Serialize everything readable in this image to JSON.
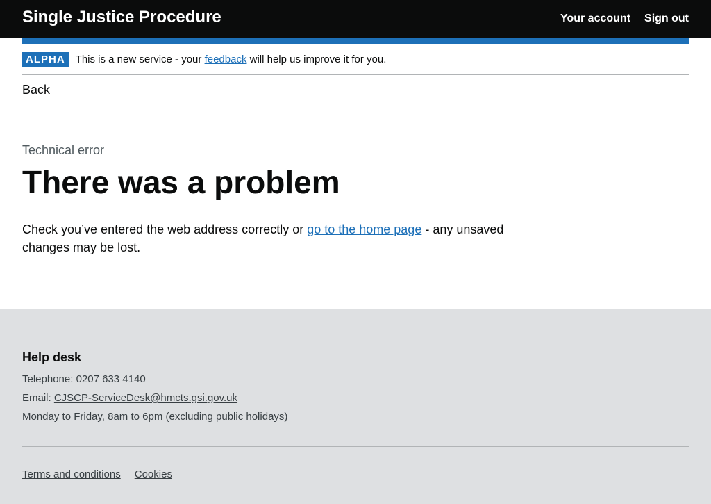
{
  "header": {
    "service_name": "Single Justice Procedure",
    "nav": [
      "Your account",
      "Sign out"
    ]
  },
  "phase_banner": {
    "tag": "ALPHA",
    "text_before": "This is a new service - your ",
    "link": "feedback",
    "text_after": " will help us improve it for you."
  },
  "back_link": "Back",
  "main": {
    "caption": "Technical error",
    "heading": "There was a problem",
    "text_before": "Check you’ve entered the web address correctly or ",
    "link": "go to the home page",
    "text_after": " - any unsaved changes may be lost."
  },
  "footer": {
    "title": "Help desk",
    "telephone": "Telephone: 0207 633 4140",
    "email_label": "Email: ",
    "email": "CJSCP-ServiceDesk@hmcts.gsi.gov.uk",
    "hours": "Monday to Friday, 8am to 6pm (excluding public holidays)",
    "links": [
      "Terms and conditions",
      "Cookies"
    ]
  },
  "colors": {
    "header_bg": "#0b0c0c",
    "accent_blue": "#1d70b8",
    "footer_bg": "#dee0e2"
  }
}
